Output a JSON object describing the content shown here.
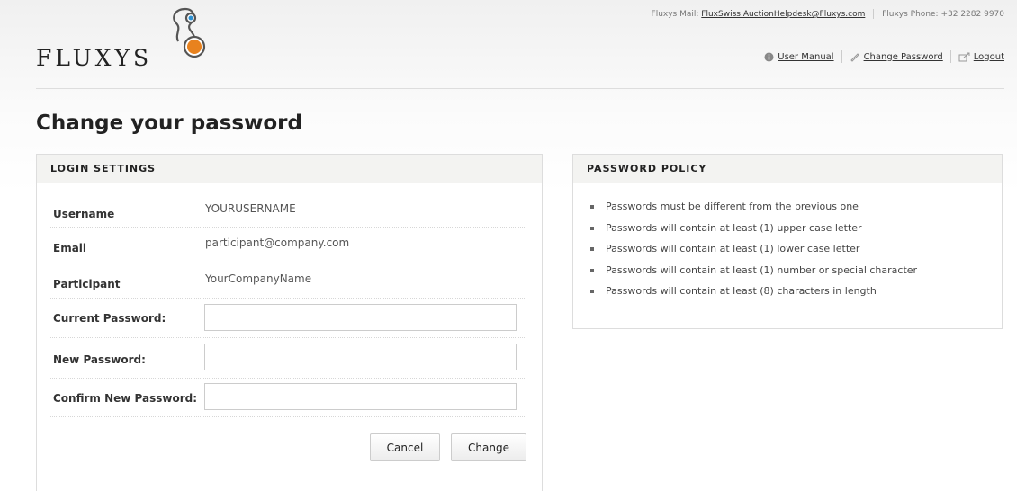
{
  "brand": {
    "name": "FLUXYS"
  },
  "contact": {
    "mail_label": "Fluxys Mail:",
    "mail_value": "FluxSwiss.AuctionHelpdesk@Fluxys.com",
    "phone_label": "Fluxys Phone:",
    "phone_value": "+32 2282 9970"
  },
  "nav": {
    "user_manual": "User Manual",
    "change_password": "Change Password",
    "logout": "Logout"
  },
  "page": {
    "title": "Change your password"
  },
  "login_settings": {
    "title": "LOGIN SETTINGS",
    "username_label": "Username",
    "username_value": "YOURUSERNAME",
    "email_label": "Email",
    "email_value": "participant@company.com",
    "participant_label": "Participant",
    "participant_value": "YourCompanyName",
    "current_password_label": "Current Password:",
    "current_password_value": "",
    "new_password_label": "New Password:",
    "new_password_value": "",
    "confirm_password_label": "Confirm New Password:",
    "confirm_password_value": "",
    "cancel_label": "Cancel",
    "change_label": "Change"
  },
  "policy": {
    "title": "PASSWORD POLICY",
    "items": [
      "Passwords must be different from the previous one",
      "Passwords will contain at least (1) upper case letter",
      "Passwords will contain at least (1) lower case letter",
      "Passwords will contain at least (1) number or special character",
      "Passwords will contain at least (8) characters in length"
    ]
  },
  "colors": {
    "accent_orange": "#e8821e",
    "accent_blue": "#2b8fd1"
  },
  "icons": {
    "logo": "fluxys-logo-mark",
    "info": "info-icon",
    "pencil": "pencil-icon",
    "logout": "logout-icon"
  }
}
